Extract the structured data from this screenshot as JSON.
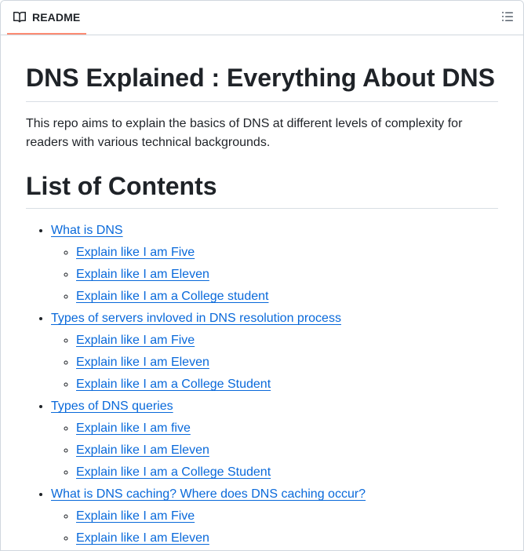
{
  "header": {
    "tab_label": "README",
    "tab_icon": "book-icon",
    "outline_icon": "list-unordered-icon",
    "accent_color": "#fd8c73"
  },
  "article": {
    "title": "DNS Explained : Everything About DNS",
    "intro": "This repo aims to explain the basics of DNS at different levels of complexity for readers with various technical backgrounds.",
    "contents_heading": "List of Contents",
    "link_color": "#0969da",
    "toc": [
      {
        "label": "What is DNS",
        "children": [
          "Explain like I am Five",
          "Explain like I am Eleven",
          "Explain like I am a College student"
        ]
      },
      {
        "label": "Types of servers invloved in DNS resolution process",
        "children": [
          "Explain like I am Five",
          "Explain like I am Eleven",
          "Explain like I am a College Student"
        ]
      },
      {
        "label": "Types of DNS queries",
        "children": [
          "Explain like I am five",
          "Explain like I am Eleven",
          "Explain like I am a College Student"
        ]
      },
      {
        "label": "What is DNS caching? Where does DNS caching occur?",
        "children": [
          "Explain like I am Five",
          "Explain like I am Eleven"
        ]
      }
    ]
  }
}
